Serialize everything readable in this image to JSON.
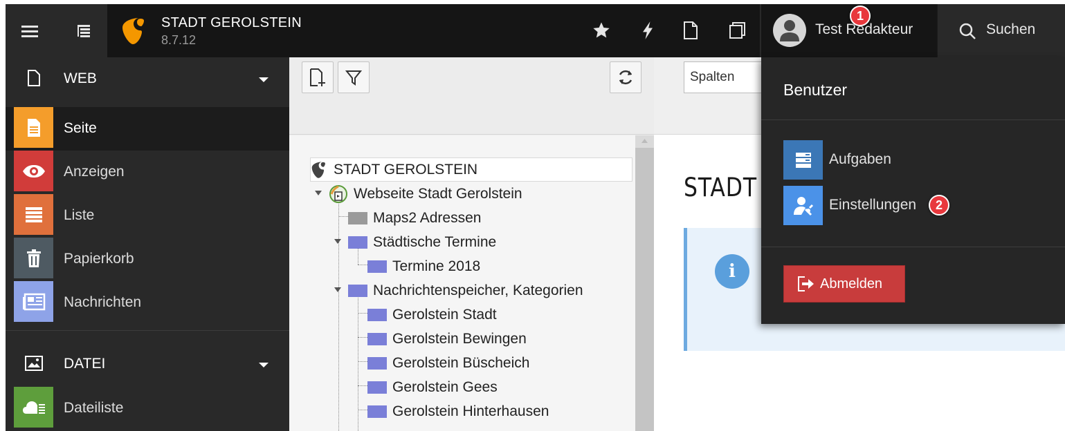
{
  "topbar": {
    "site_name": "STADT GEROLSTEIN",
    "version": "8.7.12",
    "user_name": "Test Redakteur",
    "search_label": "Suchen",
    "badge_1": "1",
    "badge_2": "2"
  },
  "sidebar": {
    "groups": [
      {
        "label": "WEB",
        "items": [
          "Seite",
          "Anzeigen",
          "Liste",
          "Papierkorb",
          "Nachrichten"
        ]
      },
      {
        "label": "DATEI",
        "items": [
          "Dateiliste"
        ]
      }
    ]
  },
  "tree": {
    "root": "STADT GEROLSTEIN",
    "nodes": [
      "Webseite Stadt Gerolstein",
      "Maps2 Adressen",
      "Städtische Termine",
      "Termine 2018",
      "Nachrichtenspeicher, Kategorien",
      "Gerolstein Stadt",
      "Gerolstein Bewingen",
      "Gerolstein Büscheich",
      "Gerolstein Gees",
      "Gerolstein Hinterhausen"
    ]
  },
  "content": {
    "columns_select": "Spalten",
    "page_heading": "STADT"
  },
  "user_menu": {
    "header": "Benutzer",
    "items": [
      "Aufgaben",
      "Einstellungen"
    ],
    "logout": "Abmelden"
  },
  "colors": {
    "topbar": "#292929",
    "brand_bg": "#151515",
    "typo3_orange": "#f49700",
    "seite": "#f49d2b",
    "anzeigen": "#d13c3a",
    "liste": "#e0703c",
    "papierkorb": "#4e5a62",
    "nachrichten": "#8ea3e8",
    "dateiliste": "#5e9e3c",
    "aufgaben": "#3b77b6",
    "einstellungen": "#4b92e8",
    "folder": "#7a7fd8",
    "logout": "#c83c3c",
    "badge": "#e8383d"
  }
}
